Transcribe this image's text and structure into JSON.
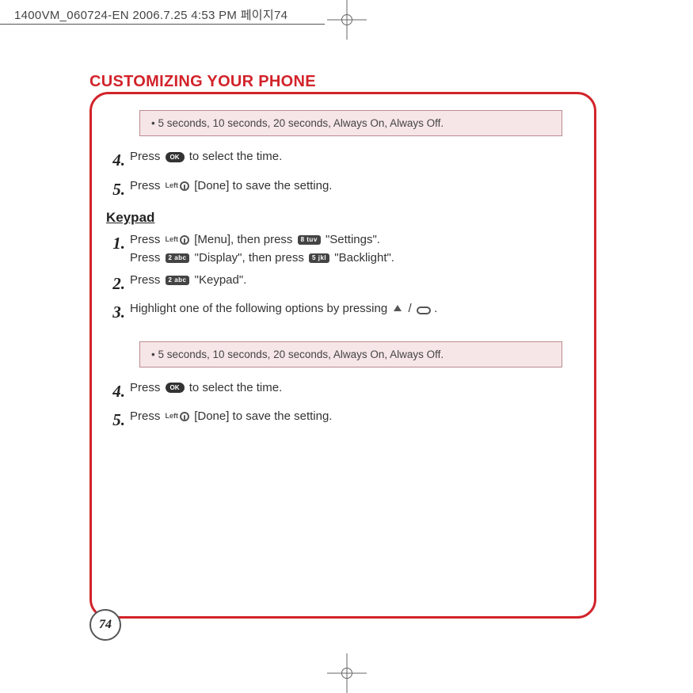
{
  "header": {
    "filestamp": "1400VM_060724-EN  2006.7.25 4:53 PM  페이지74"
  },
  "title": "CUSTOMIZING YOUR PHONE",
  "page_number": "74",
  "notes": {
    "options": "• 5 seconds, 10 seconds, 20 seconds, Always On, Always Off."
  },
  "steps_a": {
    "s4_num": "4.",
    "s4_a": "Press ",
    "s4_b": " to select the time.",
    "s5_num": "5.",
    "s5_a": "Press ",
    "s5_b": " [Done] to save the setting."
  },
  "section": {
    "keypad": "Keypad"
  },
  "keys": {
    "ok": "OK",
    "left": "Left",
    "k8": "8 tuv",
    "k2": "2 abc",
    "k5": "5 jkl"
  },
  "steps_b": {
    "s1_num": "1.",
    "s1_a": "Press ",
    "s1_b": " [Menu], then press ",
    "s1_c": " \"Settings\".",
    "s1_d": "Press ",
    "s1_e": " \"Display\", then press ",
    "s1_f": " \"Backlight\".",
    "s2_num": "2.",
    "s2_a": "Press ",
    "s2_b": " \"Keypad\".",
    "s3_num": "3.",
    "s3_a": "Highlight one of the following options by pressing ",
    "s3_sep": " / ",
    "s3_end": " ."
  }
}
